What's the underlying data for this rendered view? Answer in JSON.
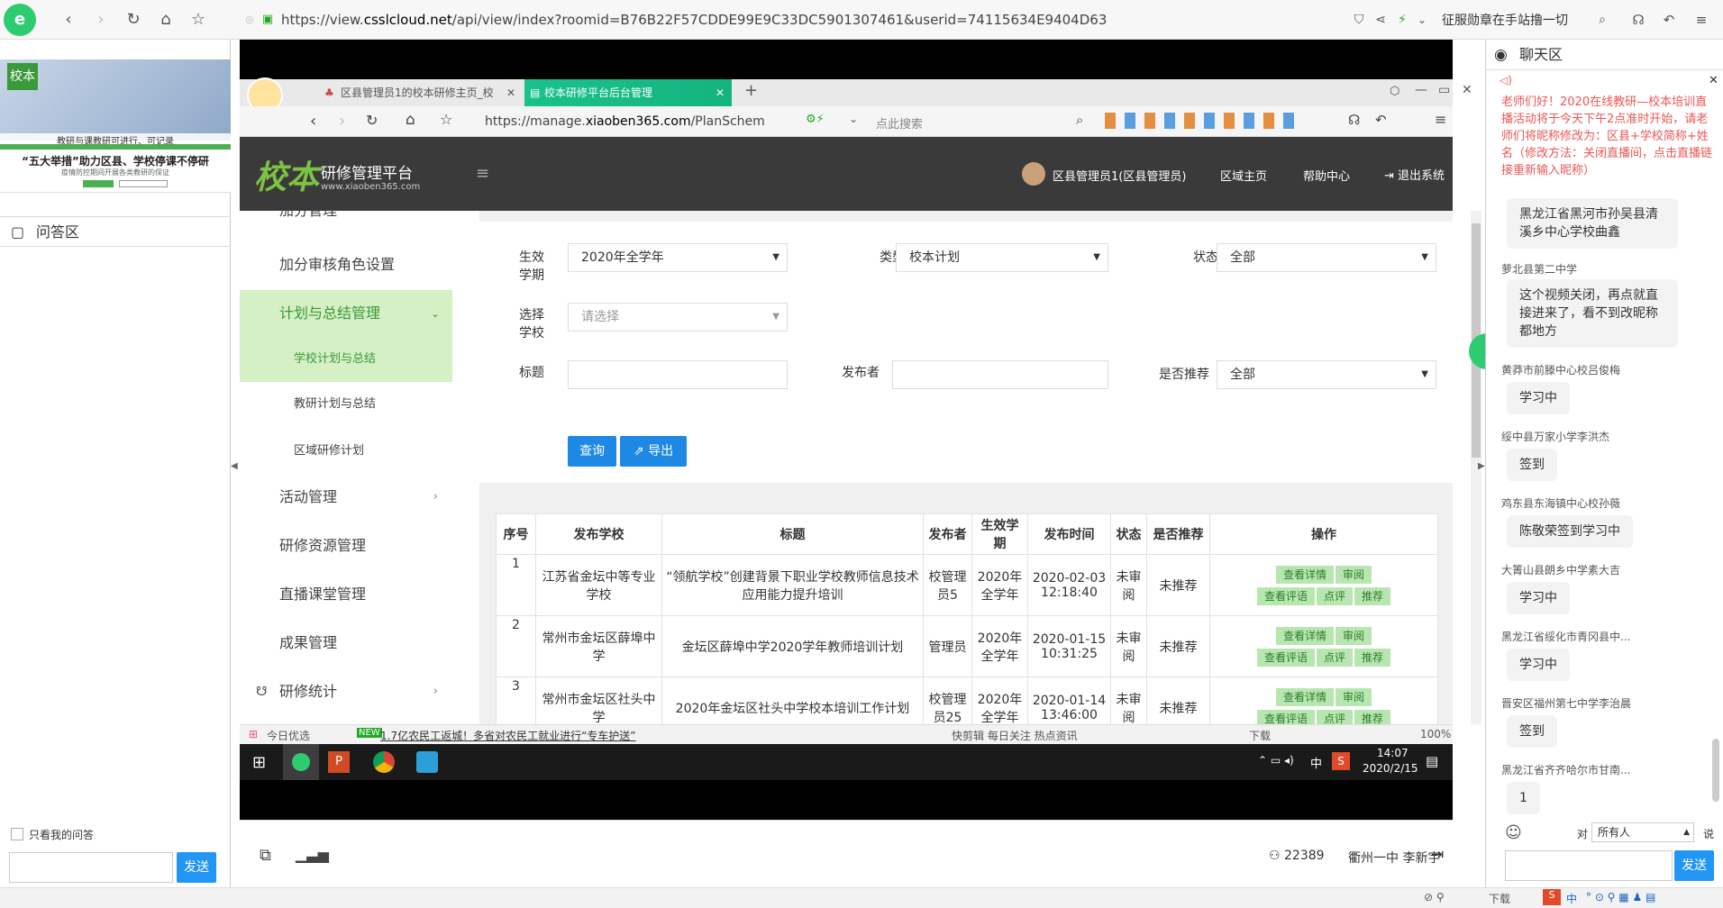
{
  "outer_browser": {
    "url_prefix": "https://view.",
    "url_domain": "csslcloud.net",
    "url_rest": "/api/view/index?roomid=B76B22F57CDDE99E9C33DC5901307461&userid=74115634E9404D63",
    "promo": "征服勋章在手站撸一切"
  },
  "left_panel": {
    "ppt_caption1": "教研与课教研可进行、可记录",
    "ppt_caption2": "“五大举措”助力区县、学校停课不停研",
    "ppt_caption3": "疫情防控期间开展各类教研的保证",
    "qa_title": "问答区",
    "only_mine": "只看我的问答",
    "send": "发送"
  },
  "inner_tabs": [
    {
      "label": "区县管理员1的校本研修主页_校"
    },
    {
      "label": "校本研修平台后台管理"
    }
  ],
  "inner_nav": {
    "url_prefix": "https://manage.",
    "url_domain": "xiaoben365.com",
    "url_rest": "/PlanSchem",
    "search_placeholder": "点此搜索"
  },
  "app_header": {
    "logo_text": "校本",
    "platform": "研修管理平台",
    "site": "www.xiaoben365.com",
    "user": "区县管理员1(区县管理员)",
    "home": "区域主页",
    "help": "帮助中心",
    "logout": "退出系统"
  },
  "side_menu": {
    "items": [
      {
        "label": "加分管理"
      },
      {
        "label": "加分审核角色设置"
      },
      {
        "label": "计划与总结管理"
      },
      {
        "label": "学校计划与总结"
      },
      {
        "label": "教研计划与总结"
      },
      {
        "label": "区域研修计划"
      },
      {
        "label": "活动管理"
      },
      {
        "label": "研修资源管理"
      },
      {
        "label": "直播课堂管理"
      },
      {
        "label": "成果管理"
      },
      {
        "label": "研修统计"
      }
    ]
  },
  "filters": {
    "term_label": "生效学期",
    "term_value": "2020年全学年",
    "type_label": "类型",
    "type_value": "校本计划",
    "status_label": "状态",
    "status_value": "全部",
    "school_label": "选择学校",
    "school_placeholder": "请选择",
    "title_label": "标题",
    "publisher_label": "发布者",
    "recommend_label": "是否推荐",
    "recommend_value": "全部",
    "query": "查询",
    "export": "导出"
  },
  "table": {
    "headers": [
      "序号",
      "发布学校",
      "标题",
      "发布者",
      "生效学期",
      "发布时间",
      "状态",
      "是否推荐",
      "操作"
    ],
    "rows": [
      {
        "no": "1",
        "school": "江苏省金坛中等专业学校",
        "title": "“领航学校”创建背景下职业学校教师信息技术应用能力提升培训",
        "publisher": "校管理员5",
        "term": "2020年全学年",
        "time": "2020-02-03 12:18:40",
        "status": "未审阅",
        "recommend": "未推荐"
      },
      {
        "no": "2",
        "school": "常州市金坛区薛埠中学",
        "title": "金坛区薛埠中学2020学年教师培训计划",
        "publisher": "管理员",
        "term": "2020年全学年",
        "time": "2020-01-15 10:31:25",
        "status": "未审阅",
        "recommend": "未推荐"
      },
      {
        "no": "3",
        "school": "常州市金坛区社头中学",
        "title": "2020年金坛区社头中学校本培训工作计划",
        "publisher": "校管理员25",
        "term": "2020年全学年",
        "time": "2020-01-14 13:46:00",
        "status": "未审阅",
        "recommend": "未推荐"
      }
    ],
    "ops": [
      "查看详情",
      "审阅",
      "查看评语",
      "点评",
      "推荐"
    ]
  },
  "inner_status": {
    "today": "今日优选",
    "news": "1.7亿农民工返城！多省对农民工就业进行“专车护送”",
    "tools": "快剪辑   每日关注   热点资讯",
    "download": "下载",
    "zoom": "100%"
  },
  "taskbar": {
    "time": "14:07",
    "date": "2020/2/15",
    "ime": "中"
  },
  "bottom_bar": {
    "viewers": "22389",
    "user": "衢州一中 李新宇"
  },
  "chat": {
    "title": "聊天区",
    "notice": "老师们好！2020在线教研—校本培训直播活动将于今天下午2点准时开始，请老师们将昵称修改为：区县+学校简称+姓名（修改方法：关闭直播间，点击直播链接重新输入昵称）",
    "messages": [
      {
        "name": "",
        "text": "黑龙江省黑河市孙吴县清溪乡中心学校曲鑫"
      },
      {
        "name": "萝北县第二中学",
        "text": "这个视频关闭，再点就直接进来了，看不到改昵称都地方"
      },
      {
        "name": "黄莽市前滕中心校吕俊梅",
        "text": "学习中"
      },
      {
        "name": "绥中县万家小学李洪杰",
        "text": "签到"
      },
      {
        "name": "鸡东县东海镇中心校孙薇",
        "text": "陈敬荣签到学习中"
      },
      {
        "name": "大箐山县朗乡中学素大吉",
        "text": "学习中"
      },
      {
        "name": "黑龙江省绥化市青冈县中...",
        "text": "学习中"
      },
      {
        "name": "晋安区福州第七中学李治晨",
        "text": "签到"
      },
      {
        "name": "黑龙江省齐齐哈尔市甘南...",
        "text": "1"
      }
    ],
    "to_label": "对",
    "to_value": "所有人",
    "say": "说",
    "send": "发送"
  },
  "outer_status": {
    "download": "下载",
    "ime": "中"
  }
}
